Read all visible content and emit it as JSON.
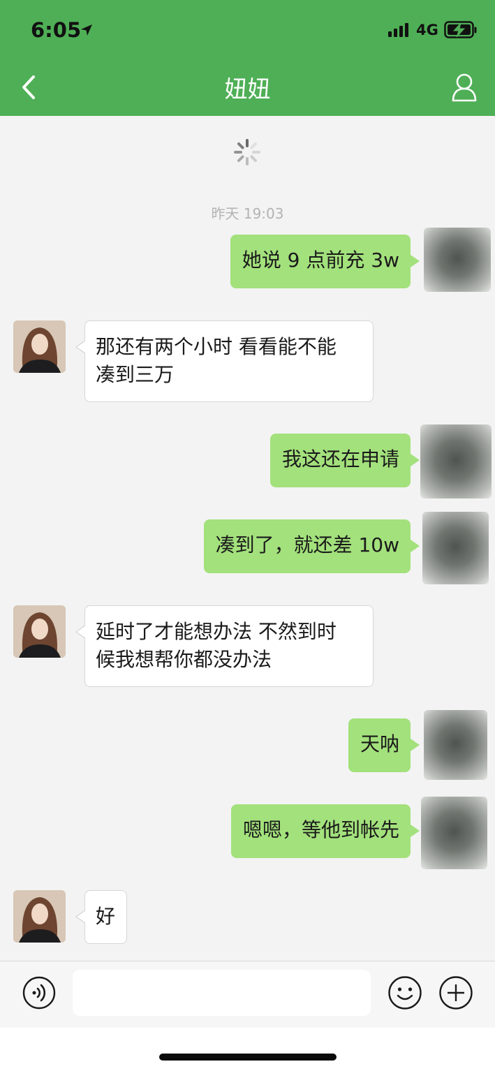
{
  "status_bar": {
    "time": "6:05",
    "network": "4G"
  },
  "nav": {
    "title": "妞妞"
  },
  "chat": {
    "timestamp": "昨天 19:03",
    "messages": [
      {
        "from": "me",
        "text": "她说 9 点前充 3w"
      },
      {
        "from": "contact",
        "text": "那还有两个小时 看看能不能\n凑到三万"
      },
      {
        "from": "me",
        "text": "我这还在申请"
      },
      {
        "from": "me",
        "text": "凑到了，就还差 10w"
      },
      {
        "from": "contact",
        "text": "延时了才能想办法 不然到时\n候我想帮你都没办法"
      },
      {
        "from": "me",
        "text": "天呐"
      },
      {
        "from": "me",
        "text": "嗯嗯，等他到帐先"
      },
      {
        "from": "contact",
        "text": "好"
      }
    ]
  },
  "input_bar": {
    "message_value": ""
  },
  "icons": {
    "back": "chevron-left-icon",
    "profile": "person-icon",
    "loading": "spinner-icon",
    "voice": "voice-icon",
    "emoji": "emoji-icon",
    "add": "plus-icon"
  },
  "colors": {
    "header": "#4faf56",
    "sent_bubble": "#a3e17c",
    "received_bubble": "#ffffff",
    "chat_background": "#f3f3f3"
  }
}
